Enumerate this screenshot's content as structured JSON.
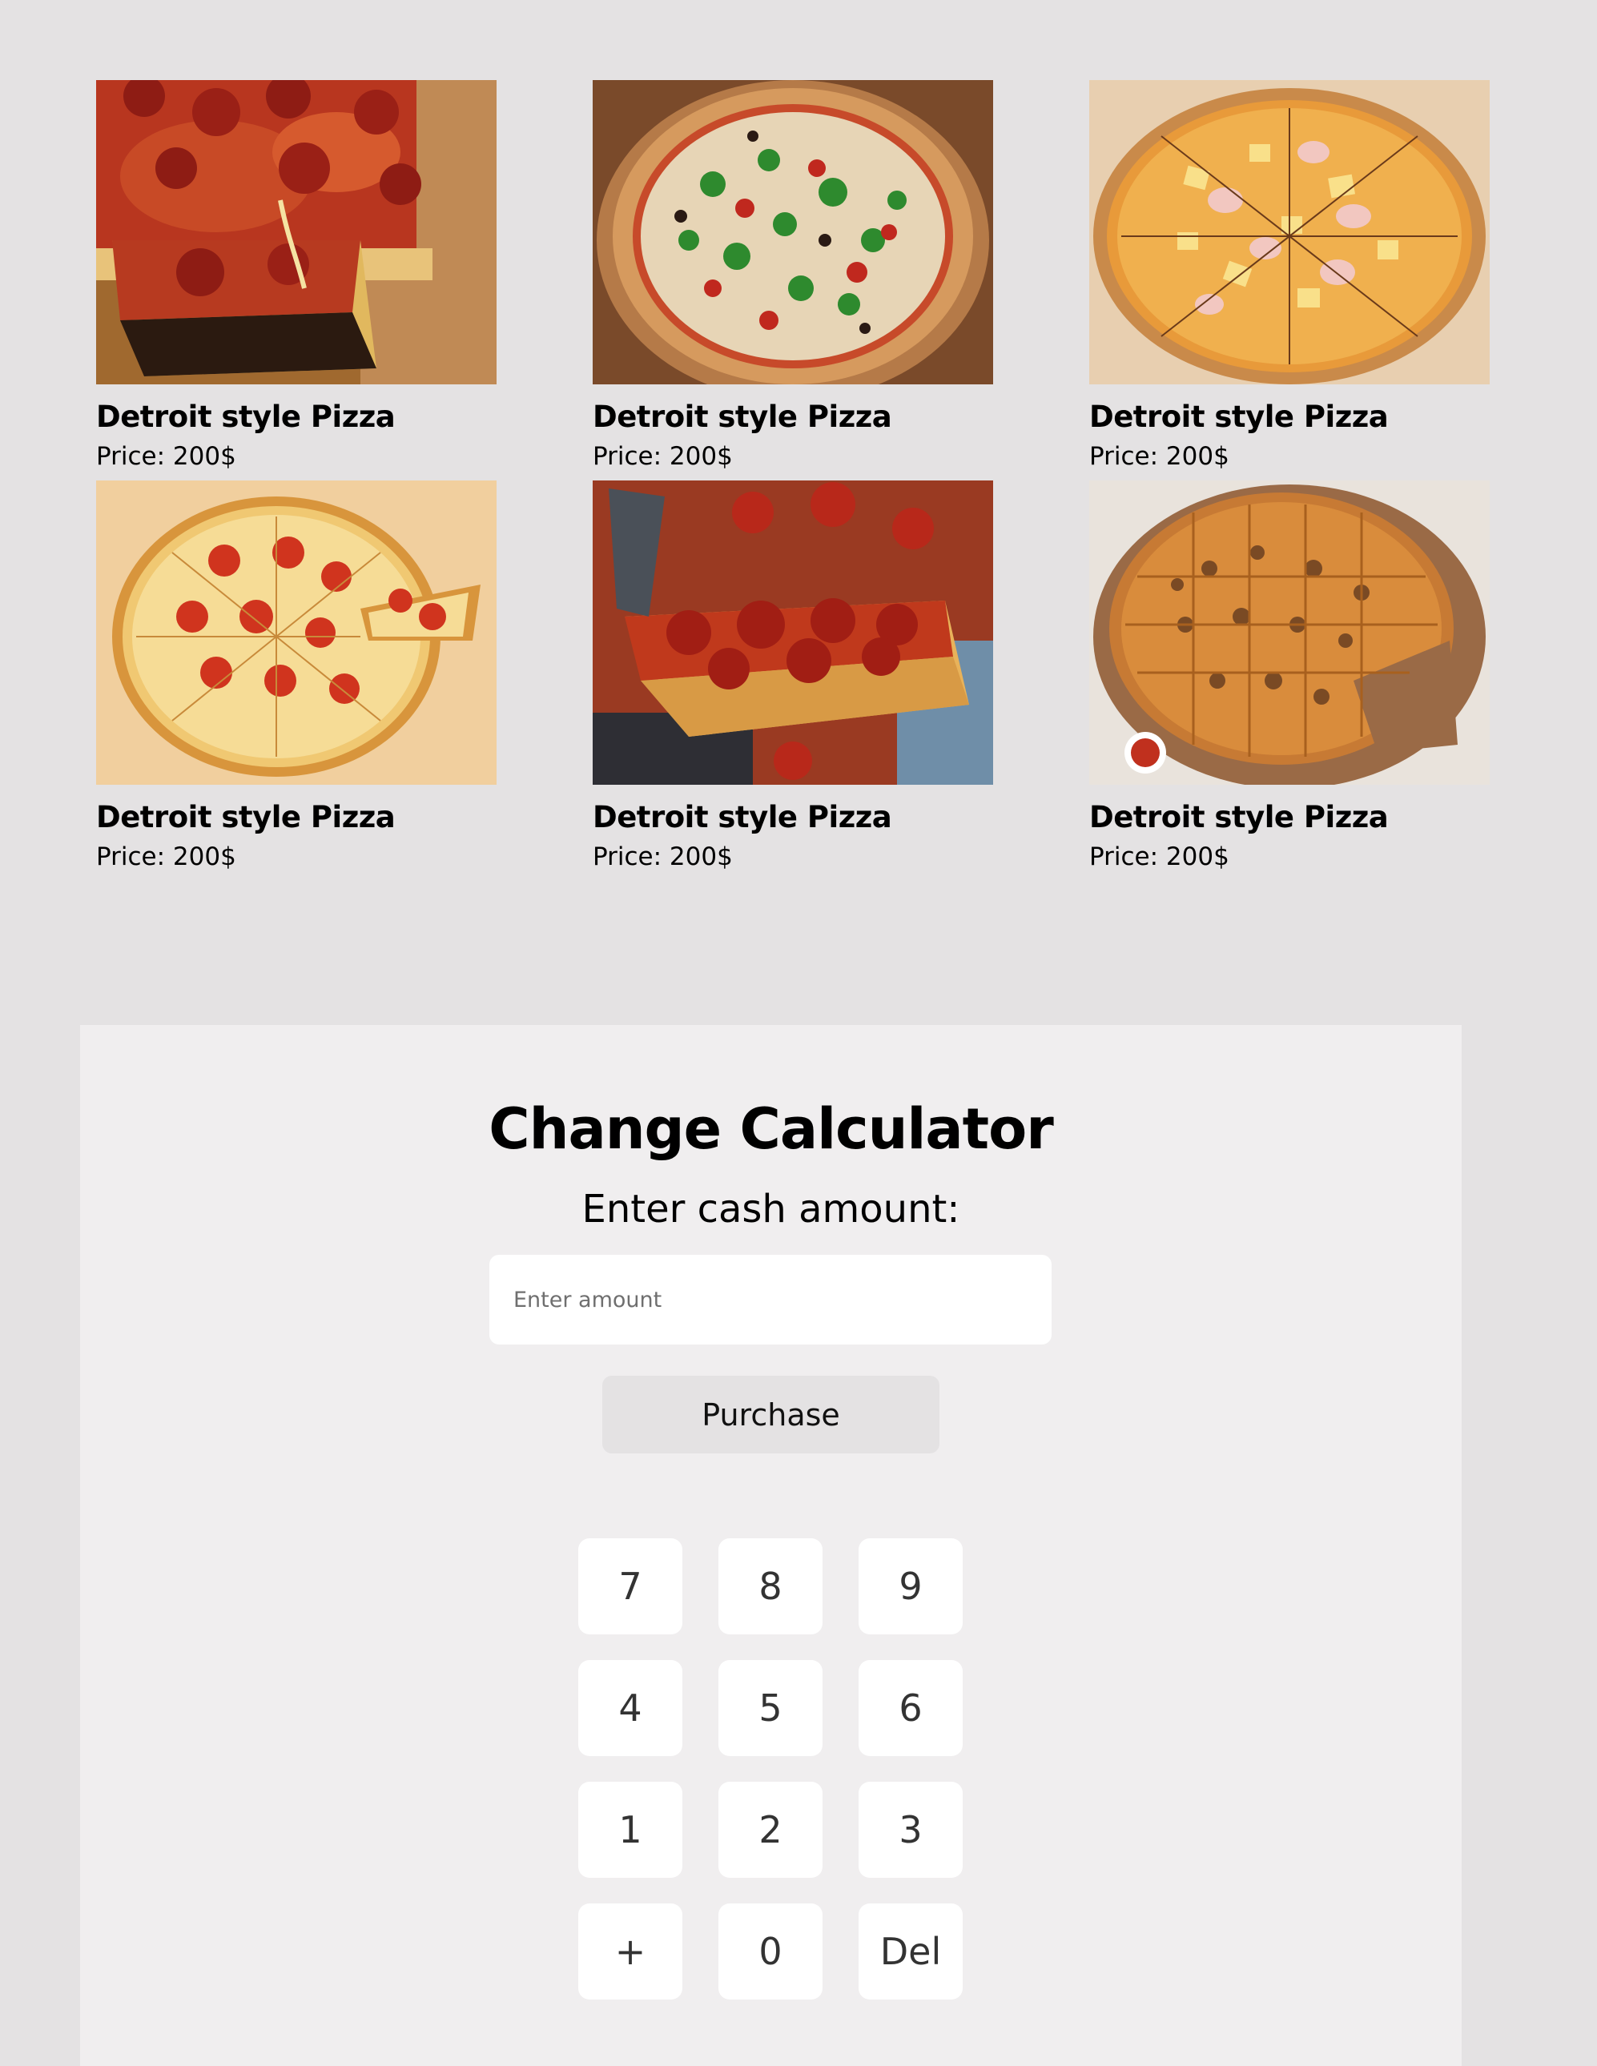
{
  "products": [
    {
      "name": "Detroit style Pizza",
      "price": "Price: 200$"
    },
    {
      "name": "Detroit style Pizza",
      "price": "Price: 200$"
    },
    {
      "name": "Detroit style Pizza",
      "price": "Price: 200$"
    },
    {
      "name": "Detroit style Pizza",
      "price": "Price: 200$"
    },
    {
      "name": "Detroit style Pizza",
      "price": "Price: 200$"
    },
    {
      "name": "Detroit style Pizza",
      "price": "Price: 200$"
    }
  ],
  "calculator": {
    "title": "Change Calculator",
    "label": "Enter cash amount:",
    "input_placeholder": "Enter amount",
    "input_value": "",
    "purchase_label": "Purchase",
    "keys": [
      "7",
      "8",
      "9",
      "4",
      "5",
      "6",
      "1",
      "2",
      "3",
      "+",
      "0",
      "Del"
    ]
  },
  "colors": {
    "page_background": "#e4e2e3",
    "panel_background": "#f0eeef",
    "key_background": "#ffffff",
    "button_background": "#e4e2e3"
  }
}
